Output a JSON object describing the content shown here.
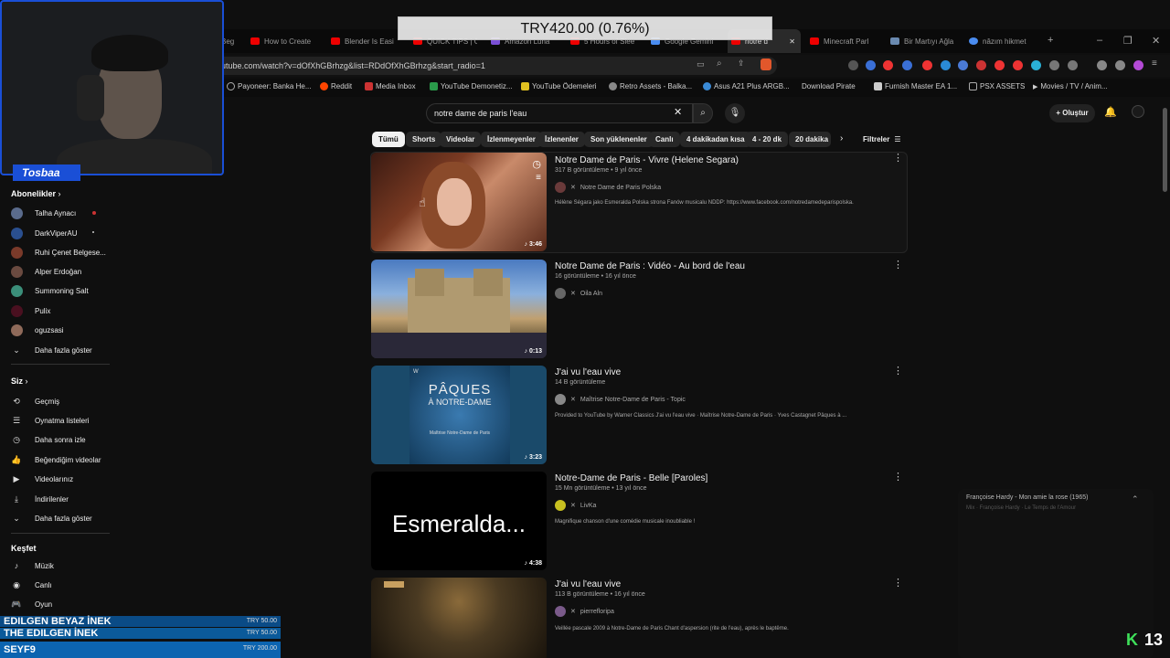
{
  "overlay": {
    "donation_banner": "TRY420.00 (0.76%)",
    "streamer_name": "Tosbaa",
    "donations": [
      {
        "name": "EDILGEN BEYAZ İNEK",
        "amount": "TRY 50.00"
      },
      {
        "name": "THE EDILGEN İNEK",
        "amount": "TRY 50.00"
      },
      {
        "name": "SEYF9",
        "amount": "TRY 200.00"
      }
    ],
    "kick_count": "13"
  },
  "browser": {
    "tabs": [
      "Beg",
      "How to Create",
      "Blender Is Easi",
      "QUICK TIPS | C",
      "Amazon Luna",
      "5 Hours of Slee",
      "Google Gemini",
      "notre d",
      "Minecraft Parl",
      "Bir Martıyı Ağla",
      "nâzım hikmet"
    ],
    "url": "utube.com/watch?v=dOfXhGBrhzg&list=RDdOfXhGBrhzg&start_radio=1",
    "bookmarks": [
      "Payoneer: Banka He...",
      "Reddit",
      "Media Inbox",
      "YouTube Demonetiz...",
      "YouTube Ödemeleri",
      "Retro Assets - Balka...",
      "Asus A21 Plus ARGB...",
      "Download Pirate",
      "Furnish Master EA 1...",
      "PSX ASSETS",
      "Movies / TV / Anim..."
    ]
  },
  "header": {
    "search_value": "notre dame de paris l'eau",
    "create_label": "Oluştur"
  },
  "chips": {
    "items": [
      "Tümü",
      "Shorts",
      "Videolar",
      "İzlenmeyenler",
      "İzlenenler",
      "Son yüklenenler",
      "Canlı",
      "4 dakikadan kısa",
      "4 - 20 dk",
      "20 dakika"
    ],
    "filters_label": "Filtreler"
  },
  "sidebar": {
    "subs_header": "Abonelikler",
    "subs": [
      {
        "name": "Talha Aynacı",
        "color": "#5a6b8c"
      },
      {
        "name": "DarkViperAU",
        "color": "#2a4f8f"
      },
      {
        "name": "Ruhi Çenet Belgese...",
        "color": "#7a3a2a"
      },
      {
        "name": "Alper Erdoğan",
        "color": "#6a4a40"
      },
      {
        "name": "Summoning Salt",
        "color": "#3b8f7a"
      },
      {
        "name": "Pulix",
        "color": "#4a1020"
      },
      {
        "name": "oguzsasi",
        "color": "#8f6a5a"
      }
    ],
    "subs_more": "Daha fazla göster",
    "you_header": "Siz",
    "you_items": [
      "Geçmiş",
      "Oynatma listeleri",
      "Daha sonra izle",
      "Beğendiğim videolar",
      "Videolarınız",
      "İndirilenler",
      "Daha fazla göster"
    ],
    "explore_header": "Keşfet",
    "explore_items": [
      "Müzik",
      "Canlı",
      "Oyun"
    ]
  },
  "results": [
    {
      "title": "Notre Dame de Paris - Vivre (Helene Segara)",
      "meta": "317 B görüntüleme • 9 yıl önce",
      "channel": "Notre Dame de Paris Polska",
      "desc": "Hélène Ségara jako Esmeralda Polska strona Fanów musicalu NDDP: https://www.facebook.com/notredamedeparispolska.",
      "duration": "3:46"
    },
    {
      "title": "Notre Dame de Paris : Vidéo - Au bord de l'eau",
      "meta": "16 görüntüleme • 16 yıl önce",
      "channel": "Oila Aln",
      "desc": "",
      "duration": "0:13"
    },
    {
      "title": "J'ai vu l'eau vive",
      "meta": "14 B görüntüleme",
      "channel": "Maîtrise Notre-Dame de Paris - Topic",
      "desc": "Provided to YouTube by Warner Classics J'ai vu l'eau vive · Maîtrise Notre-Dame de Paris · Yves Castagnet Pâques à ...",
      "duration": "3:23",
      "thumb_title": "PÂQUES",
      "thumb_sub": "À NOTRE-DAME",
      "thumb_caption": "Maîtrise Notre-Dame de Paris"
    },
    {
      "title": "Notre-Dame de Paris - Belle [Paroles]",
      "meta": "15 Mn görüntüleme • 13 yıl önce",
      "channel": "LivKa",
      "desc": "Magnifique chanson d'une comédie musicale inoubliable !",
      "duration": "4:38",
      "thumb_text": "Esmeralda..."
    },
    {
      "title": "J'ai vu l'eau vive",
      "meta": "113 B görüntüleme • 16 yıl önce",
      "channel": "pierrefloripa",
      "desc": "Veillée pascale 2009 à Notre-Dame de Paris Chant d'aspersion (rite de l'eau), après le baptême.",
      "duration": ""
    }
  ],
  "miniplayer": {
    "title": "Françoise Hardy - Mon amie la rose (1965)",
    "subtitle": "Mix · Françoise Hardy · Le Temps de l'Amour"
  }
}
